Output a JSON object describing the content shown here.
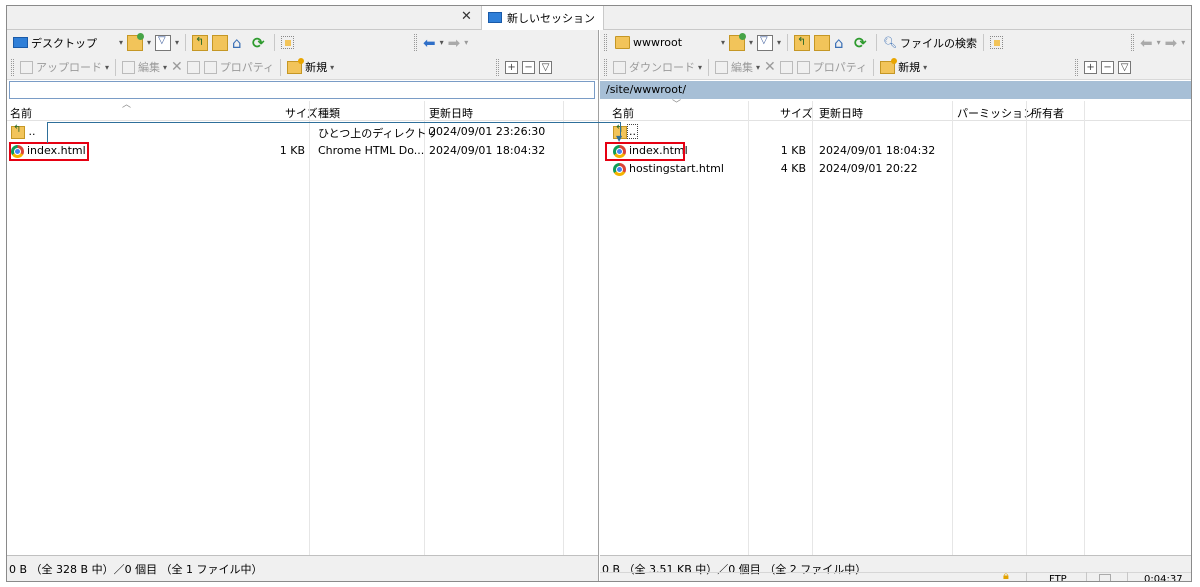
{
  "session_tab": {
    "label": "新しいセッション"
  },
  "left": {
    "location": "デスクトップ",
    "toolbar": {
      "upload": "アップロード",
      "edit": "編集",
      "properties": "プロパティ",
      "new": "新規"
    },
    "path": "",
    "columns": {
      "name": "名前",
      "size": "サイズ",
      "type": "種類",
      "modified": "更新日時"
    },
    "rows": [
      {
        "name": "..",
        "size": "",
        "type": "ひとつ上のディレクトリ",
        "modified": "2024/09/01 23:26:30"
      },
      {
        "name": "index.html",
        "size": "1 KB",
        "type": "Chrome HTML Do...",
        "modified": "2024/09/01 18:04:32"
      }
    ],
    "status": "0 B （全 328 B 中）／0 個目 （全 1 ファイル中）"
  },
  "right": {
    "location": "wwwroot",
    "toolbar": {
      "find": "ファイルの検索",
      "download": "ダウンロード",
      "edit": "編集",
      "properties": "プロパティ",
      "new": "新規"
    },
    "path": "/site/wwwroot/",
    "columns": {
      "name": "名前",
      "size": "サイズ",
      "modified": "更新日時",
      "permissions": "パーミッション",
      "owner": "所有者"
    },
    "rows": [
      {
        "name": "..",
        "size": "",
        "modified": ""
      },
      {
        "name": "index.html",
        "size": "1 KB",
        "modified": "2024/09/01 18:04:32"
      },
      {
        "name": "hostingstart.html",
        "size": "4 KB",
        "modified": "2024/09/01 20:22"
      }
    ],
    "status": "0 B （全 3.51 KB 中）／0 個目 （全 2 ファイル中）"
  },
  "statusbar": {
    "protocol": "FTP",
    "elapsed": "0:04:37"
  },
  "colors": {
    "highlight": "#e60012",
    "path_bar": "#a7bfd6",
    "drag_line": "#2e6f9a"
  }
}
